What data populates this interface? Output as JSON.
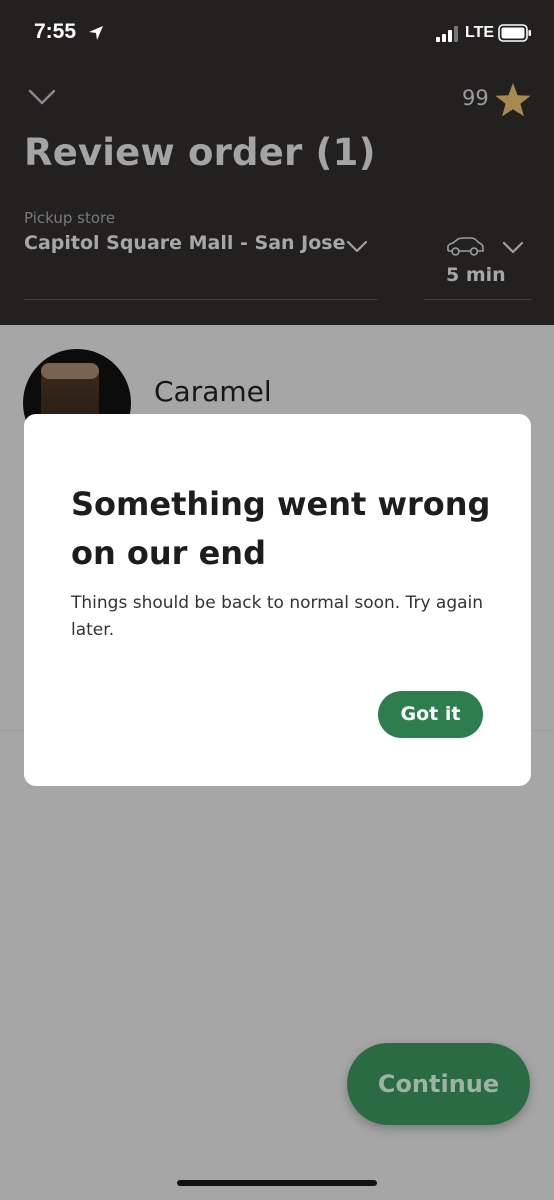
{
  "status_bar": {
    "time": "7:55",
    "network": "LTE"
  },
  "header": {
    "stars_count": "99",
    "title": "Review order (1)",
    "pickup_label": "Pickup store",
    "store_name": "Capitol Square Mall - San Jose",
    "eta": "5 min"
  },
  "order": {
    "items": [
      {
        "name": "Caramel"
      }
    ]
  },
  "modal": {
    "title": "Something went wrong on our end",
    "body": "Things should be back to normal soon. Try again later.",
    "button_label": "Got it"
  },
  "footer": {
    "continue_label": "Continue"
  },
  "colors": {
    "accent": "#2e7d4f",
    "star": "#cba258",
    "header_bg": "#222120"
  }
}
